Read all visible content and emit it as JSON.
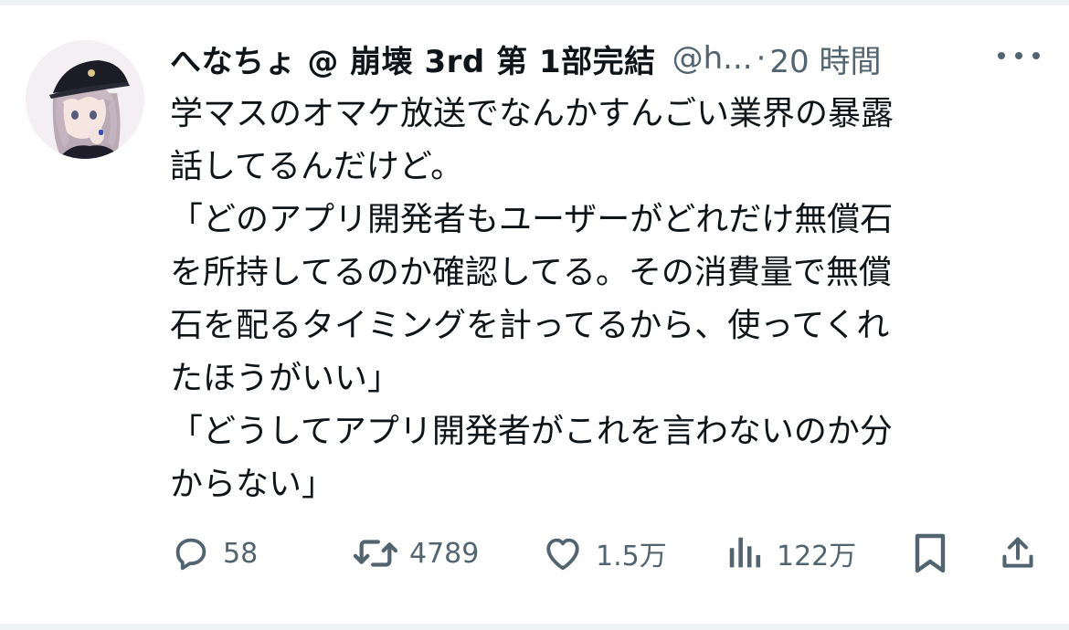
{
  "tweet": {
    "display_name": "へなちょ @ 崩壊 3rd 第 1部完結",
    "handle": "@h...",
    "separator": "·",
    "time": "20 時間",
    "lines": [
      "学マスのオマケ放送でなんかすんごい業界の暴露",
      "話してるんだけど。",
      "「どのアプリ開発者もユーザーがどれだけ無償石",
      "を所持してるのか確認してる。その消費量で無償",
      "石を配るタイミングを計ってるから、使ってくれ",
      "たほうがいい」",
      "「どうしてアプリ開発者がこれを言わないのか分",
      "からない」"
    ]
  },
  "actions": {
    "reply": {
      "icon": "reply-icon",
      "count": "58"
    },
    "retweet": {
      "icon": "retweet-icon",
      "count": "4789"
    },
    "like": {
      "icon": "heart-icon",
      "count": "1.5万"
    },
    "views": {
      "icon": "views-icon",
      "count": "122万"
    },
    "bookmark": {
      "icon": "bookmark-icon"
    },
    "share": {
      "icon": "share-icon"
    }
  },
  "colors": {
    "text": "#0f1419",
    "secondary": "#536471",
    "divider": "#eff3f4"
  }
}
